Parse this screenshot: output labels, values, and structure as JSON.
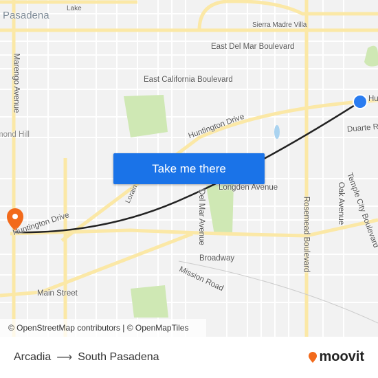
{
  "map": {
    "labels": {
      "pasadena": "Pasadena",
      "lake": "Lake",
      "sierra_madre_villa": "Sierra Madre Villa",
      "east_del_mar": "East Del Mar Boulevard",
      "marengo": "Marengo Avenue",
      "east_california": "East California Boulevard",
      "huntington_center": "Huntington Drive",
      "huntington_right": "Huntington Drive",
      "huntington_left": "Huntington Drive",
      "duarte": "Duarte Road",
      "richmond_hill": "Richmond Hill",
      "lorain": "Lorain Road",
      "longden": "Longden Avenue",
      "del_mar_ave": "Del Mar Avenue",
      "rosemead": "Rosemead Boulevard",
      "oak": "Oak Avenue",
      "temple_city": "Temple City Boulevard",
      "broadway": "Broadway",
      "mission": "Mission Road",
      "main": "Main Street"
    },
    "origin_marker_color": "#2a7cf0",
    "destination_marker_color": "#f26a1b",
    "route_color": "#222222",
    "attribution": "© OpenStreetMap contributors | © OpenMapTiles"
  },
  "cta": {
    "label": "Take me there"
  },
  "footer": {
    "origin": "Arcadia",
    "destination": "South Pasadena",
    "arrow": "⟶",
    "brand": "moovit",
    "brand_color": "#f26a1b"
  }
}
